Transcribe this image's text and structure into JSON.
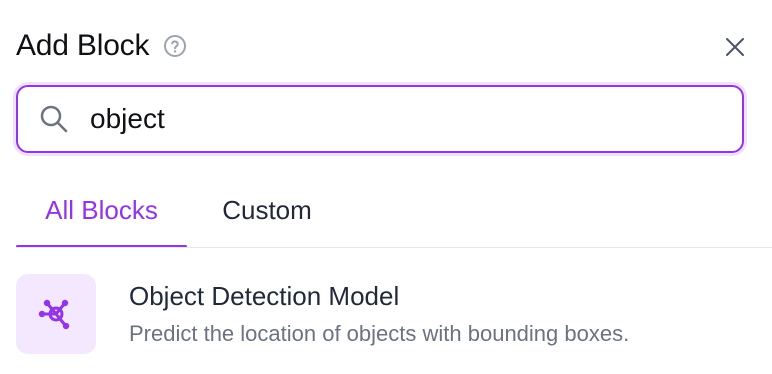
{
  "dialog": {
    "title": "Add Block",
    "help_icon": "question-circle-icon",
    "close_icon": "close-icon"
  },
  "search": {
    "icon": "search-icon",
    "value": "object",
    "accent_color": "#9333ea"
  },
  "tabs": [
    {
      "label": "All Blocks",
      "active": true
    },
    {
      "label": "Custom",
      "active": false
    }
  ],
  "results": [
    {
      "icon": "graph-nodes-icon",
      "title": "Object Detection Model",
      "description": "Predict the location of objects with bounding boxes."
    }
  ]
}
